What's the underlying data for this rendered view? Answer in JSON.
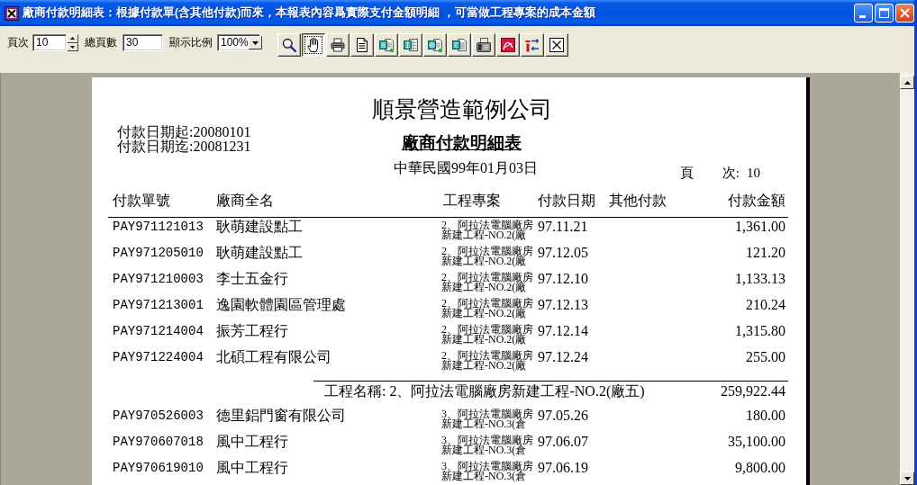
{
  "window": {
    "title": "廠商付款明細表：根據付款單(含其他付款)而來，本報表內容爲實際支付金額明細 ，可當做工程專案的成本金額"
  },
  "toolbar": {
    "page_label": "頁次",
    "page_value": "10",
    "total_label": "總頁數",
    "total_value": "30",
    "zoom_label": "顯示比例",
    "zoom_value": "100%",
    "buttons": [
      {
        "kind": "zoom",
        "selected": false
      },
      {
        "kind": "hand",
        "selected": true
      },
      {
        "kind": "print",
        "selected": false
      },
      {
        "kind": "page",
        "selected": false
      },
      {
        "kind": "word",
        "selected": false
      },
      {
        "kind": "excel",
        "selected": false
      },
      {
        "kind": "html",
        "selected": false
      },
      {
        "kind": "text",
        "selected": false
      },
      {
        "kind": "fax",
        "selected": false
      },
      {
        "kind": "pdf",
        "selected": false
      },
      {
        "kind": "convert",
        "selected": false
      },
      {
        "kind": "close",
        "selected": false
      }
    ]
  },
  "report": {
    "company": "順景營造範例公司",
    "date_from": "付款日期起:20080101",
    "date_to": "付款日期迄:20081231",
    "title": "廠商付款明細表",
    "print_date": "中華民國99年01月03日",
    "page_label": "頁 次:",
    "page_number": "10",
    "columns": [
      "付款單號",
      "廠商全名",
      "工程專案",
      "付款日期",
      "其他付款",
      "付款金額"
    ],
    "rows": [
      {
        "kind": "payment",
        "voucher": "PAY971121013",
        "vendor": "耿萌建設點工",
        "project": "2、阿拉法電腦廠房新建工程-NO.2(廠",
        "date": "97.11.21",
        "amount": "1,361.00"
      },
      {
        "kind": "payment",
        "voucher": "PAY971205010",
        "vendor": "耿萌建設點工",
        "project": "2、阿拉法電腦廠房新建工程-NO.2(廠",
        "date": "97.12.05",
        "amount": "121.20"
      },
      {
        "kind": "payment",
        "voucher": "PAY971210003",
        "vendor": "李士五金行",
        "project": "2、阿拉法電腦廠房新建工程-NO.2(廠",
        "date": "97.12.10",
        "amount": "1,133.13"
      },
      {
        "kind": "payment",
        "voucher": "PAY971213001",
        "vendor": "逸園軟體園區管理處",
        "project": "2、阿拉法電腦廠房新建工程-NO.2(廠",
        "date": "97.12.13",
        "amount": "210.24"
      },
      {
        "kind": "payment",
        "voucher": "PAY971214004",
        "vendor": "振芳工程行",
        "project": "2、阿拉法電腦廠房新建工程-NO.2(廠",
        "date": "97.12.14",
        "amount": "1,315.80"
      },
      {
        "kind": "payment",
        "voucher": "PAY971224004",
        "vendor": "北碩工程有限公司",
        "project": "2、阿拉法電腦廠房新建工程-NO.2(廠",
        "date": "97.12.24",
        "amount": "255.00"
      },
      {
        "kind": "subtotal",
        "label": "工程名稱: 2、阿拉法電腦廠房新建工程-NO.2(廠五)",
        "amount": "259,922.44"
      },
      {
        "kind": "payment",
        "voucher": "PAY970526003",
        "vendor": "德里鋁門窗有限公司",
        "project": "3、阿拉法電腦廠房新建工程-NO.3(倉",
        "date": "97.05.26",
        "amount": "180.00"
      },
      {
        "kind": "payment",
        "voucher": "PAY970607018",
        "vendor": "風中工程行",
        "project": "3、阿拉法電腦廠房新建工程-NO.3(倉",
        "date": "97.06.07",
        "amount": "35,100.00"
      },
      {
        "kind": "payment",
        "voucher": "PAY970619010",
        "vendor": "風中工程行",
        "project": "3、阿拉法電腦廠房新建工程-NO.3(倉",
        "date": "97.06.19",
        "amount": "9,800.00"
      }
    ]
  }
}
